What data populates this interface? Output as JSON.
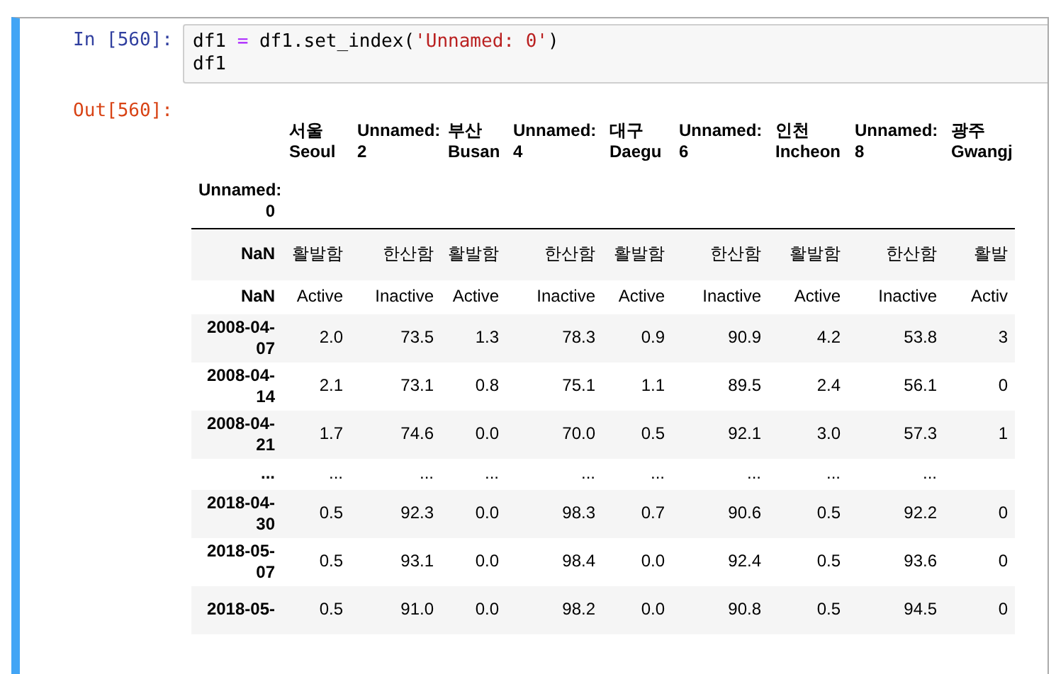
{
  "input": {
    "prompt": "In [560]:",
    "code": [
      [
        {
          "kind": "plain",
          "text": "df1 "
        },
        {
          "kind": "operator",
          "text": "="
        },
        {
          "kind": "plain",
          "text": " df1.set_index("
        },
        {
          "kind": "string",
          "text": "'Unnamed: 0'"
        },
        {
          "kind": "plain",
          "text": ")"
        }
      ],
      [
        {
          "kind": "plain",
          "text": "df1"
        }
      ]
    ]
  },
  "output": {
    "prompt": "Out[560]:",
    "table": {
      "columns": [
        "서울 Seoul",
        "Unnamed: 2",
        "부산 Busan",
        "Unnamed: 4",
        "대구 Daegu",
        "Unnamed: 6",
        "인천 Incheon",
        "Unnamed: 8",
        "광주 Gwangj"
      ],
      "index_name": "Unnamed: 0",
      "rows": [
        {
          "index": "NaN",
          "cells": [
            "활발함",
            "한산함",
            "활발함",
            "한산함",
            "활발함",
            "한산함",
            "활발함",
            "한산함",
            "활발"
          ]
        },
        {
          "index": "NaN",
          "cells": [
            "Active",
            "Inactive",
            "Active",
            "Inactive",
            "Active",
            "Inactive",
            "Active",
            "Inactive",
            "Activ"
          ]
        },
        {
          "index": "2008-04-07",
          "cells": [
            "2.0",
            "73.5",
            "1.3",
            "78.3",
            "0.9",
            "90.9",
            "4.2",
            "53.8",
            "3"
          ]
        },
        {
          "index": "2008-04-14",
          "cells": [
            "2.1",
            "73.1",
            "0.8",
            "75.1",
            "1.1",
            "89.5",
            "2.4",
            "56.1",
            "0"
          ]
        },
        {
          "index": "2008-04-21",
          "cells": [
            "1.7",
            "74.6",
            "0.0",
            "70.0",
            "0.5",
            "92.1",
            "3.0",
            "57.3",
            "1"
          ]
        },
        {
          "index": "...",
          "cells": [
            "...",
            "...",
            "...",
            "...",
            "...",
            "...",
            "...",
            "...",
            ""
          ]
        },
        {
          "index": "2018-04-30",
          "cells": [
            "0.5",
            "92.3",
            "0.0",
            "98.3",
            "0.7",
            "90.6",
            "0.5",
            "92.2",
            "0"
          ]
        },
        {
          "index": "2018-05-07",
          "cells": [
            "0.5",
            "93.1",
            "0.0",
            "98.4",
            "0.0",
            "92.4",
            "0.5",
            "93.6",
            "0"
          ]
        },
        {
          "index": "2018-05-",
          "cells": [
            "0.5",
            "91.0",
            "0.0",
            "98.2",
            "0.0",
            "90.8",
            "0.5",
            "94.5",
            "0"
          ]
        }
      ]
    }
  }
}
